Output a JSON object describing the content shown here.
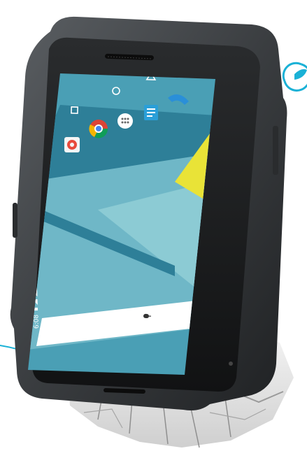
{
  "status_bar": {
    "time": "6:08"
  },
  "nav_buttons": [
    "recent-apps",
    "home",
    "back"
  ],
  "dock_apps": [
    "photos",
    "chrome",
    "app-drawer",
    "messenger",
    "phone"
  ],
  "desktop_apps": [
    "photos"
  ],
  "search_bar": {
    "icon": "microphone-icon"
  },
  "eco_badge": {
    "icon": "recycle-leaf-icon"
  },
  "colors": {
    "accent": "#1ab1d6",
    "screen_bg": "#4a9fb5",
    "screen_light": "#8ccbd4",
    "screen_mid": "#6fb7c7",
    "screen_dark": "#2e7f98",
    "yellow": "#e9e337",
    "phone_body": "#3a3d40",
    "phone_edge": "#1f2123"
  }
}
